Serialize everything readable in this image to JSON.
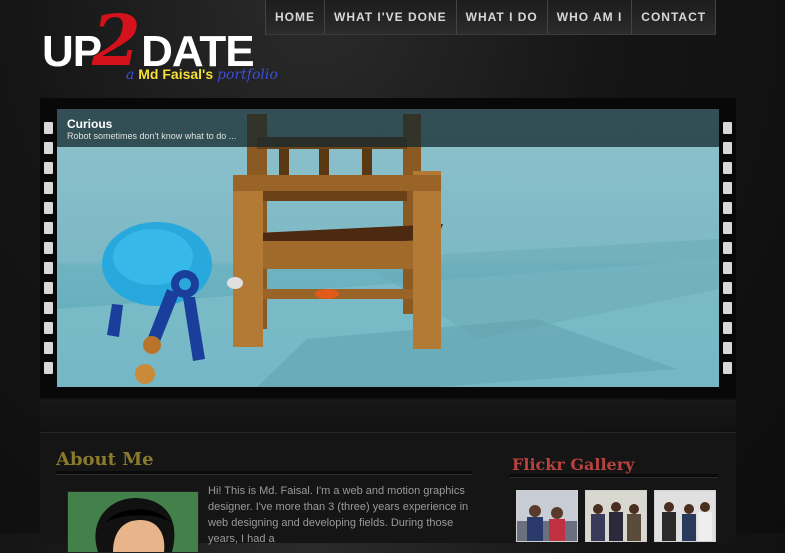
{
  "logo": {
    "prefix": "UP",
    "number": "2",
    "suffix": "DATE",
    "tag_a": "a",
    "tag_name": "Md Faisal's",
    "tag_portfolio": "portfolio"
  },
  "nav": {
    "items": [
      "HOME",
      "WHAT I'VE DONE",
      "WHAT I DO",
      "WHO AM I",
      "CONTACT"
    ]
  },
  "slider": {
    "title": "Curious",
    "text": "Robot sometimes don't know what to do ..."
  },
  "about": {
    "title": "About Me",
    "text": "Hi! This is Md. Faisal. I'm a web and motion graphics designer. I've more than 3 (three) years experience in web designing and developing fields. During those years, I had a"
  },
  "flickr": {
    "title": "Flickr Gallery"
  },
  "colors": {
    "logo_red": "#d4121b",
    "tag_yellow": "#f5df3a",
    "tag_blue": "#3a4fd8",
    "about_title": "#8a7a2c",
    "flickr_title": "#b8433e"
  }
}
